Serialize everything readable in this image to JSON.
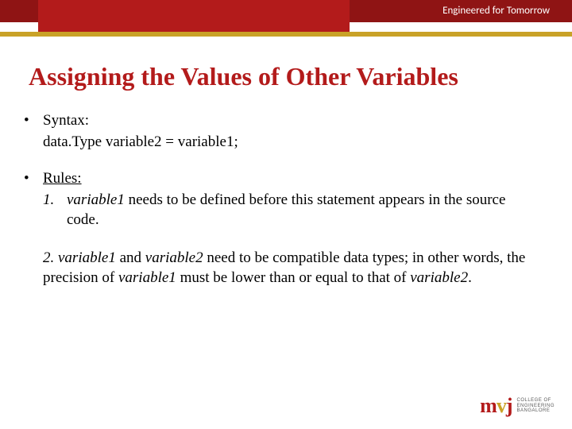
{
  "header": {
    "tagline": "Engineered for Tomorrow"
  },
  "title": "Assigning the Values of Other Variables",
  "syntax": {
    "label": "Syntax:",
    "line": "data.Type variable2 = variable1;"
  },
  "rules": {
    "label": "Rules:",
    "r1_num": "1.",
    "r1_pre": "variable1",
    "r1_post": " needs to be defined before this statement appears in the source code.",
    "r2_a": "2. ",
    "r2_v1": "variable1",
    "r2_b": " and ",
    "r2_v2": "variable2",
    "r2_c": " need to be compatible data types; in other words, the precision of ",
    "r2_v3": "variable1",
    "r2_d": " must be lower than or equal to that of ",
    "r2_v4": "variable2",
    "r2_e": "."
  },
  "logo": {
    "mark_m": "m",
    "mark_v": "v",
    "mark_j": "j",
    "line1": "COLLEGE OF",
    "line2": "ENGINEERING",
    "line3": "BANGALORE"
  }
}
